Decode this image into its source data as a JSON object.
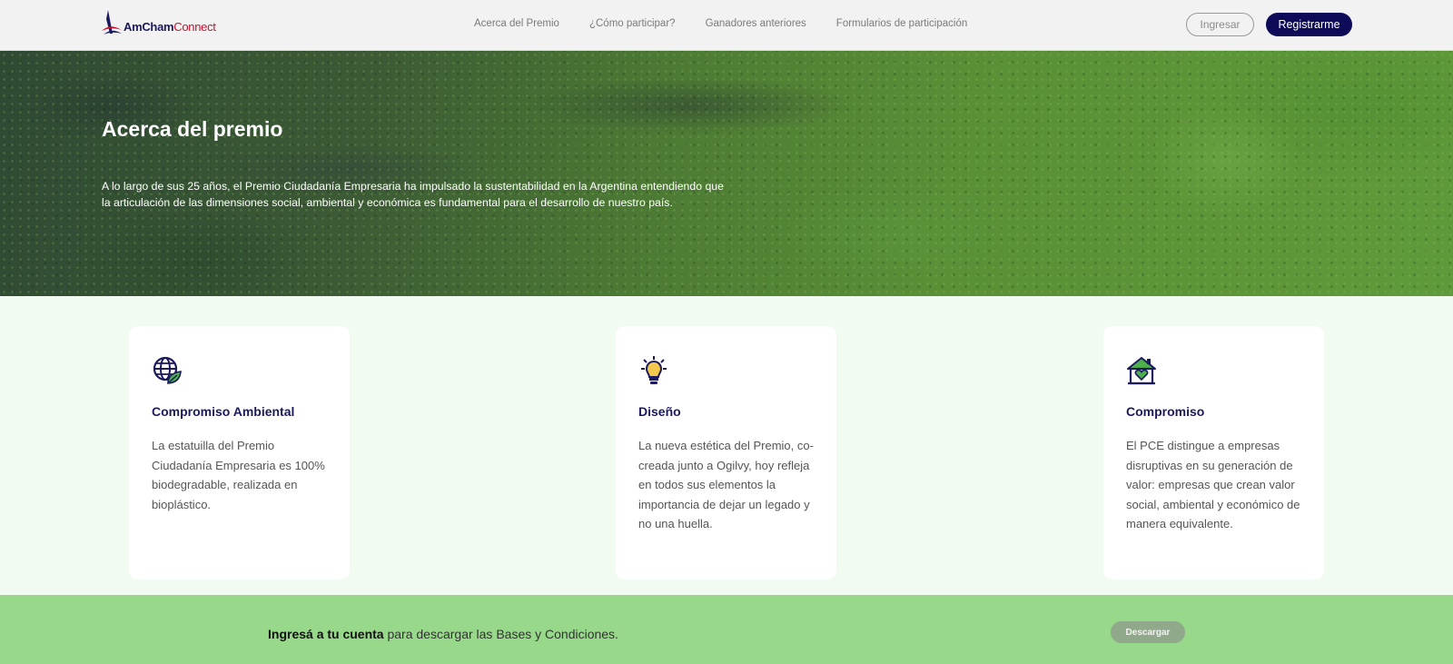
{
  "header": {
    "logo": {
      "part1": "AmCham",
      "part2": "Connect"
    },
    "nav": [
      {
        "label": "Acerca del Premio"
      },
      {
        "label": "¿Cómo participar?"
      },
      {
        "label": "Ganadores anteriores"
      },
      {
        "label": "Formularios de participación"
      }
    ],
    "login_label": "Ingresar",
    "register_label": "Registrarme"
  },
  "hero": {
    "title": "Acerca del premio",
    "text": "A lo largo de sus 25 años, el Premio Ciudadanía Empresaria ha impulsado la sustentabilidad en la Argentina entendiendo que la articulación de las dimensiones social, ambiental y económica es fundamental para el desarrollo de nuestro país."
  },
  "cards": [
    {
      "icon": "globe-leaf-icon",
      "title": "Compromiso Ambiental",
      "text": "La estatuilla del Premio Ciudadanía Empresaria es 100% biodegradable, realizada en bioplástico."
    },
    {
      "icon": "lightbulb-icon",
      "title": "Diseño",
      "text": "La nueva estética del Premio, co-creada junto a Ogilvy, hoy refleja en todos sus elementos la importancia de dejar un legado y no una huella."
    },
    {
      "icon": "house-heart-icon",
      "title": "Compromiso",
      "text": "El PCE distingue a empresas disruptivas en su generación de valor: empresas que crean valor social, ambiental y económico de manera equivalente."
    }
  ],
  "footer": {
    "bold_text": "Ingresá a tu cuenta",
    "text": " para descargar las Bases y Condiciones.",
    "download_label": "Descargar"
  },
  "colors": {
    "navy": "#0d0a57",
    "brand_red": "#c8102e",
    "footer_green": "#97d88a",
    "section_bg": "#f2fbf1"
  }
}
